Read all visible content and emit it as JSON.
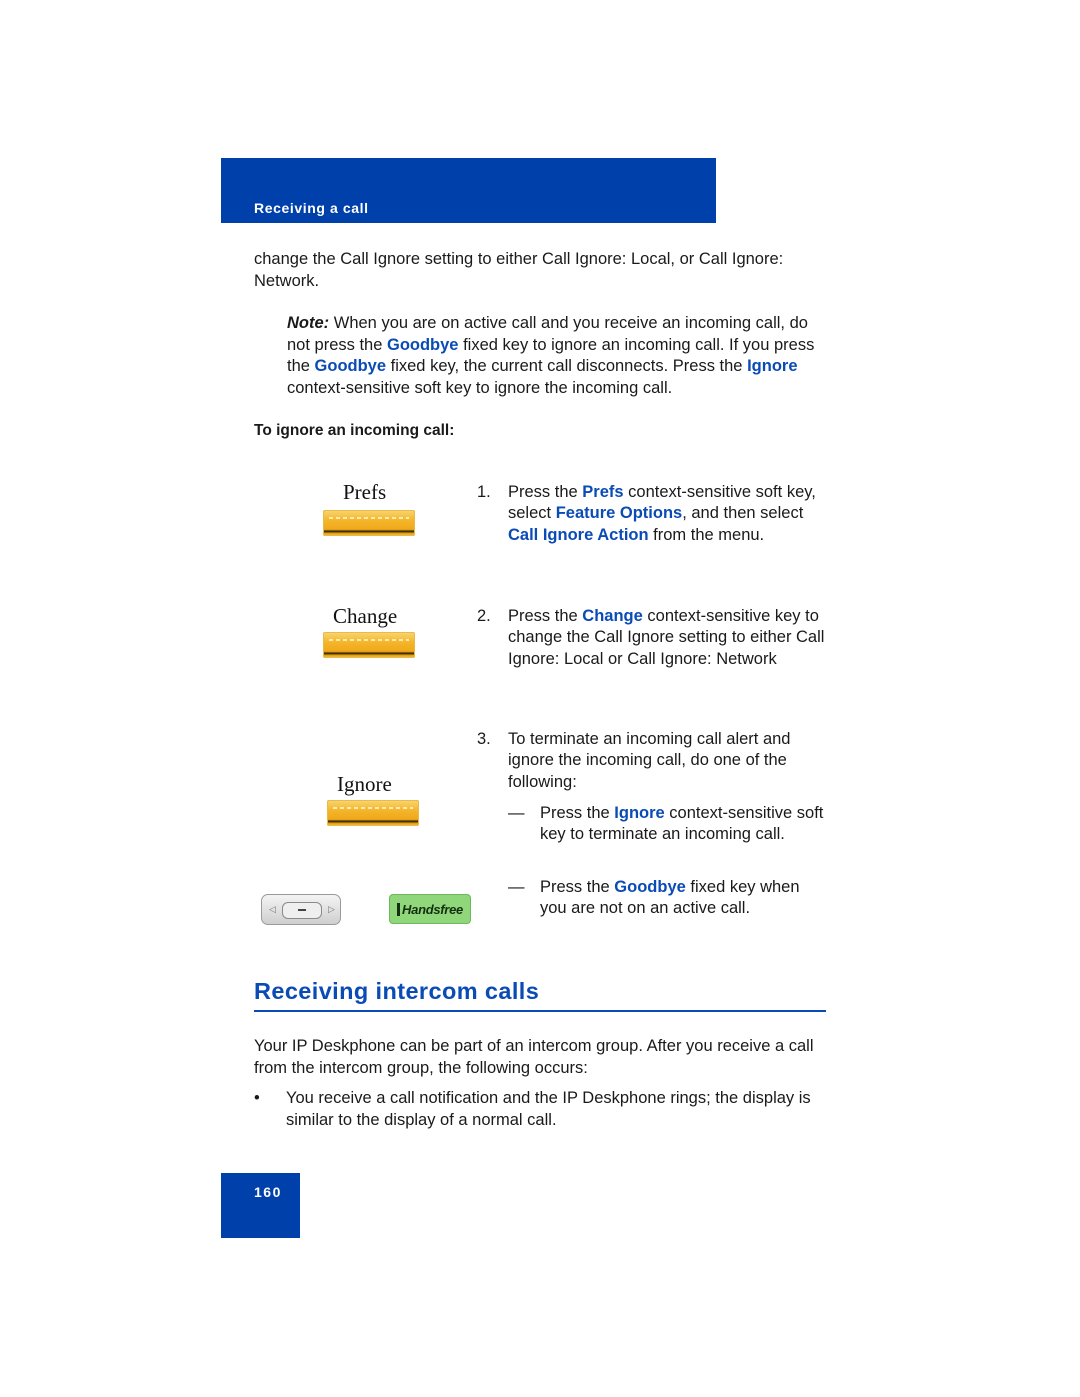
{
  "header": {
    "title": "Receiving a call"
  },
  "intro": {
    "text": "change the Call Ignore setting to either Call Ignore: Local, or Call Ignore: Network."
  },
  "note": {
    "label": "Note:",
    "parts": [
      " When you are on active call and you receive an incoming call, do not press the ",
      "Goodbye",
      " fixed key to ignore an incoming call. If you press the ",
      "Goodbye",
      " fixed key, the current call disconnects. Press the ",
      "Ignore",
      " context-sensitive soft key to ignore the incoming call."
    ]
  },
  "procedure": {
    "heading": "To ignore an incoming call:",
    "keys": [
      {
        "label": "Prefs",
        "icon": "softkey-icon"
      },
      {
        "label": "Change",
        "icon": "softkey-icon"
      },
      {
        "label": "Ignore",
        "icon": "softkey-icon"
      }
    ],
    "steps": [
      {
        "num": "1.",
        "parts": [
          "Press the ",
          "Prefs",
          " context-sensitive soft key, select ",
          "Feature Options",
          ", and then select ",
          "Call Ignore Action",
          " from the menu."
        ]
      },
      {
        "num": "2.",
        "parts": [
          "Press the ",
          "Change",
          " context-sensitive key to change the Call Ignore setting to either Call Ignore: Local or Call Ignore: Network"
        ]
      },
      {
        "num": "3.",
        "parts": [
          "To terminate an incoming call alert and ignore the incoming call, do one of the following:"
        ]
      }
    ],
    "substeps": [
      {
        "dash": "—",
        "parts": [
          "Press the ",
          "Ignore",
          " context-sensitive soft key to terminate an incoming call."
        ]
      },
      {
        "dash": "—",
        "parts": [
          "Press the ",
          "Goodbye",
          " fixed key when you are not on an active call."
        ]
      }
    ],
    "handsfree_label": "Handsfree",
    "nav_icon": "navigation-cluster-icon"
  },
  "section": {
    "title": "Receiving intercom calls",
    "body": "Your IP Deskphone can be part of an intercom group. After you receive a call from the intercom group, the following occurs:",
    "bullets": [
      {
        "dot": "•",
        "text": "You receive a call notification and the IP Deskphone rings; the display is similar to the display of a normal call."
      }
    ]
  },
  "page_number": "160",
  "colors": {
    "brand_blue": "#0040ab",
    "link_blue": "#0a4bb5",
    "softkey_amber": "#f5b52b",
    "handsfree_green": "#8fd77a"
  }
}
